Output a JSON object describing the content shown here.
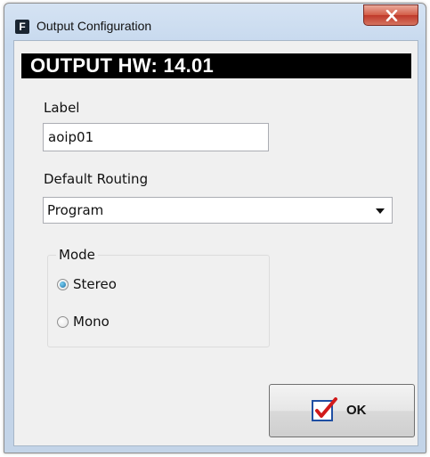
{
  "window": {
    "title": "Output Configuration",
    "app_icon_letter": "F"
  },
  "header": {
    "text": "OUTPUT HW: 14.01"
  },
  "label_field": {
    "caption": "Label",
    "value": "aoip01"
  },
  "routing": {
    "caption": "Default Routing",
    "selected": "Program"
  },
  "mode": {
    "caption": "Mode",
    "options": [
      {
        "label": "Stereo",
        "checked": true
      },
      {
        "label": "Mono",
        "checked": false
      }
    ]
  },
  "ok_button": {
    "label": "OK"
  },
  "icons": {
    "app": "app-icon",
    "close": "close-icon",
    "ok": "checkmark-icon",
    "dropdown": "chevron-down-icon"
  }
}
